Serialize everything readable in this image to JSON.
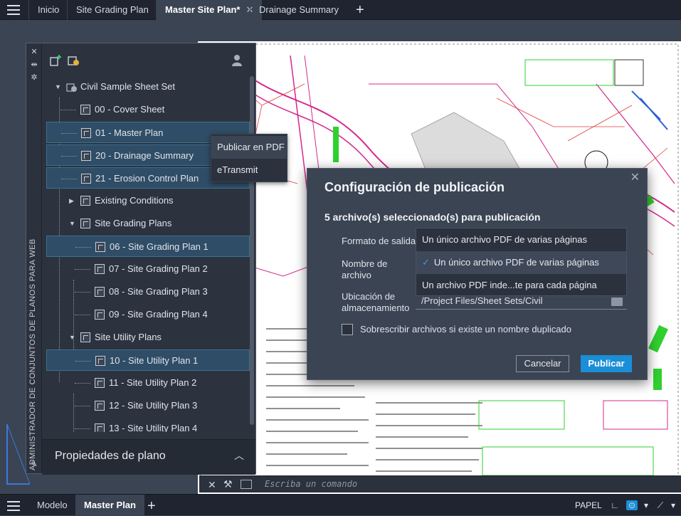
{
  "top_tabs": [
    {
      "label": "Inicio"
    },
    {
      "label": "Site Grading Plan"
    },
    {
      "label": "Master Site Plan*",
      "active": true
    },
    {
      "label": "Drainage Summary"
    }
  ],
  "palette": {
    "vertical_title": "ADMINISTRADOR DE CONJUNTOS DE PLANOS PARA WEB",
    "root": "Civil Sample Sheet Set",
    "items": [
      {
        "label": "00 - Cover Sheet"
      },
      {
        "label": "01 - Master Plan"
      },
      {
        "label": "20 - Drainage Summary"
      },
      {
        "label": "21 - Erosion Control Plan"
      },
      {
        "label": "Existing Conditions"
      },
      {
        "label": "Site Grading Plans"
      },
      {
        "label": "06 - Site Grading Plan 1"
      },
      {
        "label": "07 - Site Grading Plan 2"
      },
      {
        "label": "08 - Site Grading Plan 3"
      },
      {
        "label": "09 - Site Grading Plan 4"
      },
      {
        "label": "Site Utility Plans"
      },
      {
        "label": "10 - Site Utility Plan 1"
      },
      {
        "label": "11 - Site Utility Plan 2"
      },
      {
        "label": "12 - Site Utility Plan 3"
      },
      {
        "label": "13 - Site Utility Plan 4"
      }
    ],
    "properties_title": "Propiedades de plano"
  },
  "context_menu": {
    "items": [
      "Publicar en PDF",
      "eTransmit"
    ]
  },
  "dialog": {
    "title": "Configuración de publicación",
    "subtitle": "5 archivo(s) seleccionado(s) para publicación",
    "format_label": "Formato de salida",
    "name_label": "Nombre de archivo",
    "location_label": "Ubicación de almacenamiento",
    "dropdown_options": [
      "Un único archivo PDF de varias páginas",
      "Un único archivo PDF de varias páginas",
      "Un archivo PDF inde...te para cada página"
    ],
    "location_value": "/Project Files/Sheet Sets/Civil",
    "overwrite_label": "Sobrescribir archivos si existe un nombre duplicado",
    "cancel_label": "Cancelar",
    "publish_label": "Publicar"
  },
  "command_line": {
    "placeholder": "Escriba un comando"
  },
  "status_bar": {
    "tabs": [
      {
        "label": "Modelo"
      },
      {
        "label": "Master Plan",
        "active": true
      }
    ],
    "space_label": "PAPEL"
  },
  "colors": {
    "accent": "#1b8ed8",
    "selection": "#2f4d66",
    "panel_bg": "#3b4453"
  }
}
